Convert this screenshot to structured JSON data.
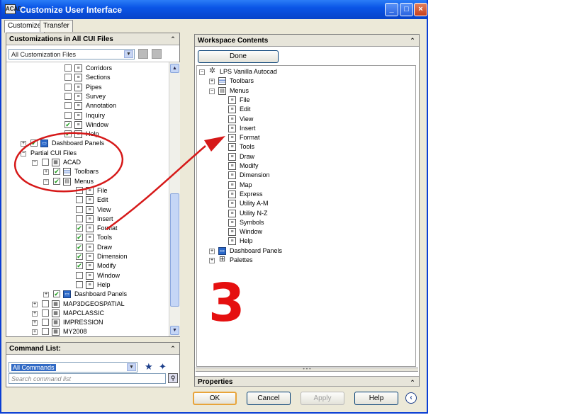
{
  "window": {
    "title": "Customize User Interface",
    "app_icon": "ACAD",
    "minimize": "_",
    "maximize": "□",
    "close": "×"
  },
  "tabs": [
    {
      "label": "Customize",
      "active": true
    },
    {
      "label": "Transfer",
      "active": false
    }
  ],
  "left_panel": {
    "header": "Customizations in All CUI Files",
    "collapse": "⌃",
    "filter_value": "All Customization Files",
    "tree": [
      {
        "label": "Corridors",
        "chk": "",
        "icon": "menu"
      },
      {
        "label": "Sections",
        "chk": "",
        "icon": "menu"
      },
      {
        "label": "Pipes",
        "chk": "",
        "icon": "menu"
      },
      {
        "label": "Survey",
        "chk": "",
        "icon": "menu"
      },
      {
        "label": "Annotation",
        "chk": "",
        "icon": "menu"
      },
      {
        "label": "Inquiry",
        "chk": "",
        "icon": "menu"
      },
      {
        "label": "Window",
        "chk": "✔",
        "icon": "menu"
      },
      {
        "label": "Help",
        "chk": "✔",
        "icon": "menu"
      },
      {
        "label": "Dashboard Panels",
        "chk": "✔",
        "icon": "dash"
      },
      {
        "label": "Partial CUI Files",
        "chk": "",
        "icon": "none"
      },
      {
        "label": "ACAD",
        "chk": "",
        "icon": "cui"
      },
      {
        "label": "Toolbars",
        "chk": "✔",
        "icon": "bars"
      },
      {
        "label": "Menus",
        "chk": "✔",
        "icon": "menus"
      },
      {
        "label": "File",
        "chk": "",
        "icon": "menu"
      },
      {
        "label": "Edit",
        "chk": "",
        "icon": "menu"
      },
      {
        "label": "View",
        "chk": "",
        "icon": "menu"
      },
      {
        "label": "Insert",
        "chk": "",
        "icon": "menu"
      },
      {
        "label": "Format",
        "chk": "✔",
        "icon": "menu"
      },
      {
        "label": "Tools",
        "chk": "✔",
        "icon": "menu"
      },
      {
        "label": "Draw",
        "chk": "✔",
        "icon": "menu"
      },
      {
        "label": "Dimension",
        "chk": "✔",
        "icon": "menu"
      },
      {
        "label": "Modify",
        "chk": "✔",
        "icon": "menu"
      },
      {
        "label": "Window",
        "chk": "",
        "icon": "menu"
      },
      {
        "label": "Help",
        "chk": "",
        "icon": "menu"
      },
      {
        "label": "Dashboard Panels",
        "chk": "✔",
        "icon": "dash"
      },
      {
        "label": "MAP3DGEOSPATIAL",
        "chk": "",
        "icon": "cui"
      },
      {
        "label": "MAPCLASSIC",
        "chk": "",
        "icon": "cui"
      },
      {
        "label": "IMPRESSION",
        "chk": "",
        "icon": "cui"
      },
      {
        "label": "MY2008",
        "chk": "",
        "icon": "cui"
      }
    ]
  },
  "command_list": {
    "header": "Command List:",
    "filter_value": "All Commands",
    "search_placeholder": "Search command list"
  },
  "right_panel": {
    "header": "Workspace Contents",
    "done_label": "Done",
    "tree": [
      {
        "label": "LPS Vanilla Autocad",
        "icon": "gear"
      },
      {
        "label": "Toolbars",
        "icon": "bars"
      },
      {
        "label": "Menus",
        "icon": "menus"
      },
      {
        "label": "File",
        "icon": "menu"
      },
      {
        "label": "Edit",
        "icon": "menu"
      },
      {
        "label": "View",
        "icon": "menu"
      },
      {
        "label": "Insert",
        "icon": "menu"
      },
      {
        "label": "Format",
        "icon": "menu"
      },
      {
        "label": "Tools",
        "icon": "menu"
      },
      {
        "label": "Draw",
        "icon": "menu"
      },
      {
        "label": "Modify",
        "icon": "menu"
      },
      {
        "label": "Dimension",
        "icon": "menu"
      },
      {
        "label": "Map",
        "icon": "menu"
      },
      {
        "label": "Express",
        "icon": "menu"
      },
      {
        "label": "Utility A-M",
        "icon": "menu"
      },
      {
        "label": "Utility N-Z",
        "icon": "menu"
      },
      {
        "label": "Symbols",
        "icon": "menu"
      },
      {
        "label": "Window",
        "icon": "menu"
      },
      {
        "label": "Help",
        "icon": "menu"
      },
      {
        "label": "Dashboard Panels",
        "icon": "dash"
      },
      {
        "label": "Palettes",
        "icon": "grid"
      }
    ]
  },
  "properties": {
    "header": "Properties"
  },
  "footer": {
    "ok": "OK",
    "cancel": "Cancel",
    "apply": "Apply",
    "help": "Help",
    "toggle": "‹"
  },
  "annotation": {
    "number": "3",
    "color": "#e51010"
  }
}
